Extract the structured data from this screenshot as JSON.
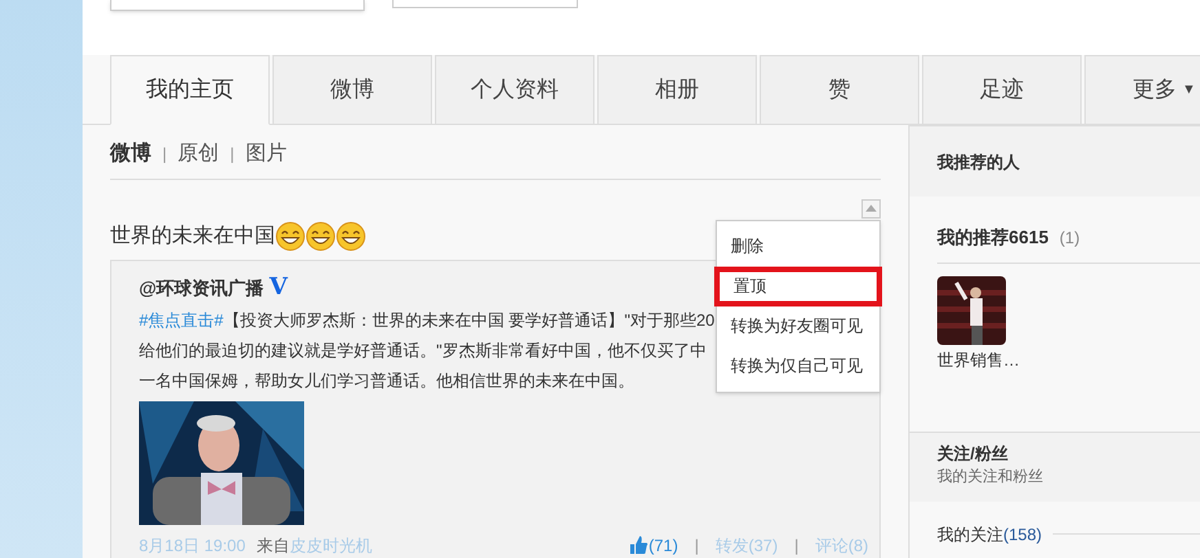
{
  "tabs": [
    {
      "label": "我的主页",
      "selected": true
    },
    {
      "label": "微博",
      "selected": false
    },
    {
      "label": "个人资料",
      "selected": false
    },
    {
      "label": "相册",
      "selected": false
    },
    {
      "label": "赞",
      "selected": false
    },
    {
      "label": "足迹",
      "selected": false
    },
    {
      "label": "更多",
      "selected": false,
      "caret": "▼"
    }
  ],
  "separator": "|",
  "subtabs": [
    {
      "label": "微博",
      "selected": true
    },
    {
      "label": "原创",
      "selected": false
    },
    {
      "label": "图片",
      "selected": false
    }
  ],
  "post": {
    "text": "世界的未来在中国",
    "emojis": [
      {
        "kind": "grin"
      },
      {
        "kind": "grin"
      },
      {
        "kind": "grin"
      }
    ],
    "repost": {
      "author": "@环球资讯广播",
      "verified_mark": "V",
      "topic": "#焦点直击#",
      "lines": [
        "【投资大师罗杰斯：世界的未来在中国 要学好普通话】\"对于那些20",
        "给他们的最迫切的建议就是学好普通话。\"罗杰斯非常看好中国，他不仅买了中",
        "一名中国保姆，帮助女儿们学习普通话。他相信世界的未来在中国。"
      ],
      "image": {
        "kind": "picture"
      },
      "time": "8月18日 19:00",
      "source_prefix": "来自",
      "source": "皮皮时光机",
      "likes": "(71)",
      "forward": "转发(37)",
      "comment": "评论(8)"
    }
  },
  "menu": [
    {
      "label": "删除",
      "selected": false
    },
    {
      "label": "置顶",
      "selected": true
    },
    {
      "label": "转换为好友圈可见",
      "selected": false
    },
    {
      "label": "转换为仅自己可见",
      "selected": false
    }
  ],
  "sidebar": {
    "title": "我推荐的人",
    "recommend_title": "我的推荐6615",
    "recommend_count": "(1)",
    "people": [
      {
        "name": "世界销售…"
      }
    ],
    "follow_title": "关注/粉丝",
    "follow_subtitle": "我的关注和粉丝",
    "following": "我的关注",
    "following_count": "(158)"
  }
}
